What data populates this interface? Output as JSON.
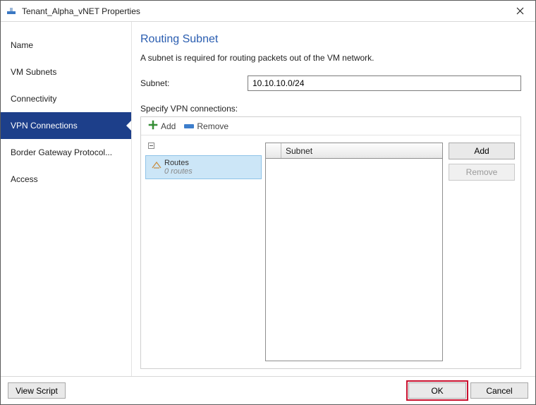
{
  "titlebar": {
    "title": "Tenant_Alpha_vNET Properties"
  },
  "sidebar": {
    "items": [
      {
        "label": "Name"
      },
      {
        "label": "VM Subnets"
      },
      {
        "label": "Connectivity"
      },
      {
        "label": "VPN Connections"
      },
      {
        "label": "Border Gateway Protocol..."
      },
      {
        "label": "Access"
      }
    ]
  },
  "main": {
    "heading": "Routing Subnet",
    "description": "A subnet is required for routing packets out of the VM network.",
    "subnet_label": "Subnet:",
    "subnet_value": "10.10.10.0/24",
    "specify_label": "Specify VPN connections:",
    "toolbar": {
      "add": "Add",
      "remove": "Remove"
    },
    "tree": {
      "routes_label": "Routes",
      "routes_count": "0 routes"
    },
    "list": {
      "col_subnet": "Subnet"
    },
    "sidebuttons": {
      "add": "Add",
      "remove": "Remove"
    }
  },
  "footer": {
    "view_script": "View Script",
    "ok": "OK",
    "cancel": "Cancel"
  }
}
